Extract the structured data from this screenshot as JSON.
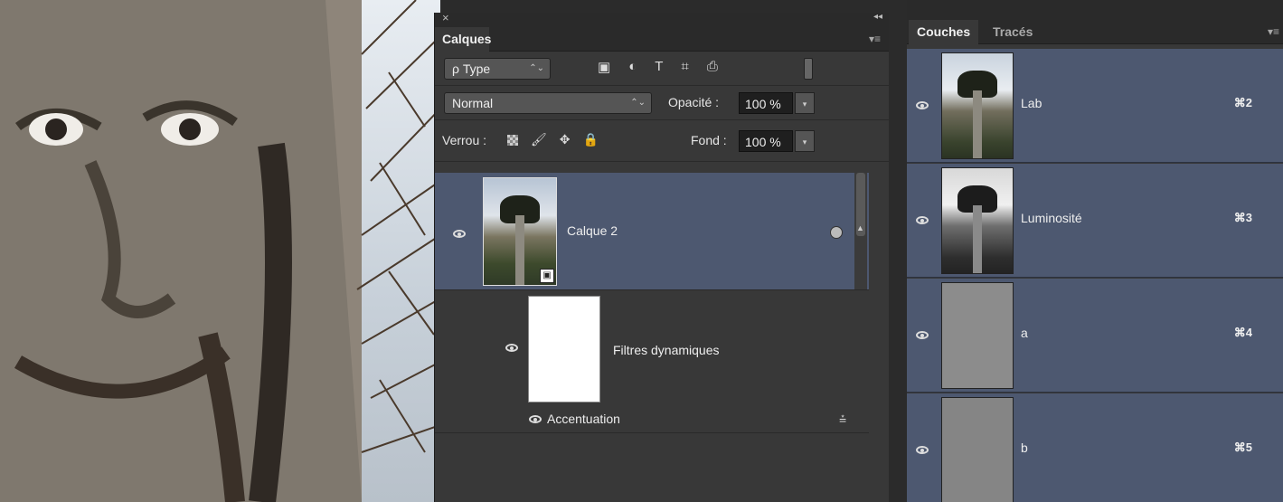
{
  "layers_panel": {
    "close_glyph": "×",
    "collapse_glyph": "◂◂",
    "tab_label": "Calques",
    "menu_glyph": "▾≡",
    "filter_select": "ρ Type",
    "filter_select_arrows": "⌃⌄",
    "filter_icons": [
      "image-filter-icon",
      "adjustment-filter-icon",
      "type-filter-icon",
      "shape-filter-icon",
      "smart-object-filter-icon"
    ],
    "filter_glyphs": [
      "▣",
      "◐",
      "T",
      "⌗",
      "⎙"
    ],
    "blend_mode": "Normal",
    "opacity_label": "Opacité :",
    "opacity_value": "100 %",
    "lock_label": "Verrou :",
    "fill_label": "Fond :",
    "fill_value": "100 %",
    "layers": [
      {
        "name": "Calque 2",
        "visible": true,
        "selected": true,
        "type": "smart-object"
      },
      {
        "name": "Filtres dynamiques",
        "visible": true,
        "type": "smart-filter-mask"
      },
      {
        "name": "Accentuation",
        "visible": true,
        "type": "smart-filter"
      }
    ]
  },
  "channels_panel": {
    "tabs": [
      "Couches",
      "Tracés"
    ],
    "menu_glyph": "▾≡",
    "channels": [
      {
        "name": "Lab",
        "shortcut": "⌘2",
        "thumb": "color"
      },
      {
        "name": "Luminosité",
        "shortcut": "⌘3",
        "thumb": "bw"
      },
      {
        "name": "a",
        "shortcut": "⌘4",
        "thumb": "gray"
      },
      {
        "name": "b",
        "shortcut": "⌘5",
        "thumb": "gray"
      }
    ]
  },
  "colors": {
    "panel_bg": "#383838",
    "selected_row": "#4d5870",
    "tab_bar": "#2a2a2a"
  }
}
